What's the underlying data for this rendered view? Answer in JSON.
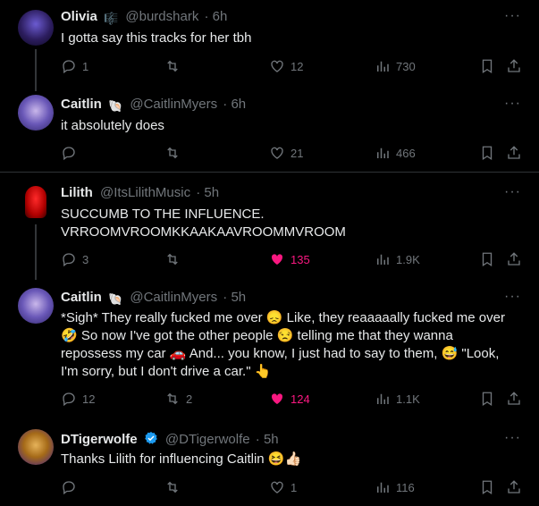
{
  "tweets": [
    {
      "name": "Olivia",
      "badge": "🎼",
      "handle": "@burdshark",
      "time": "· 6h",
      "text": "I gotta say this tracks for her tbh",
      "replies": "1",
      "retweets": "",
      "likes": "12",
      "views": "730",
      "liked": false
    },
    {
      "name": "Caitlin",
      "badge": "🐚",
      "handle": "@CaitlinMyers",
      "time": "· 6h",
      "text": "it absolutely does",
      "replies": "",
      "retweets": "",
      "likes": "21",
      "views": "466",
      "liked": false
    },
    {
      "name": "Lilith",
      "handle": "@ItsLilithMusic",
      "time": "· 5h",
      "text_lines": [
        "SUCCUMB TO THE INFLUENCE.",
        "VRROOMVROOMKKAAKAAVROOMMVROOM"
      ],
      "replies": "3",
      "retweets": "",
      "likes": "135",
      "views": "1.9K",
      "liked": true
    },
    {
      "name": "Caitlin",
      "badge": "🐚",
      "handle": "@CaitlinMyers",
      "time": "· 5h",
      "text_lines": [
        "*Sigh* They really fucked me over 😞 Like, they reaaaaally fucked me over",
        "🤣 So now I've got the other people 😒 telling me that they wanna",
        "repossess my car 🚗 And... you know, I just had to say to them, 😅 \"Look,",
        "I'm sorry, but I don't drive a car.\" 👆"
      ],
      "replies": "12",
      "retweets": "2",
      "likes": "124",
      "views": "1.1K",
      "liked": true
    },
    {
      "name": "DTigerwolfe",
      "verified": true,
      "handle": "@DTigerwolfe",
      "time": "· 5h",
      "text": "Thanks Lilith for influencing Caitlin 😆👍🏻",
      "replies": "",
      "retweets": "",
      "likes": "1",
      "views": "116",
      "liked": false
    }
  ],
  "colors": {
    "background": "#000000",
    "text": "#e7e9ea",
    "muted": "#71767b",
    "like": "#f91880",
    "verified": "#1d9bf0",
    "divider": "#2f3336"
  }
}
